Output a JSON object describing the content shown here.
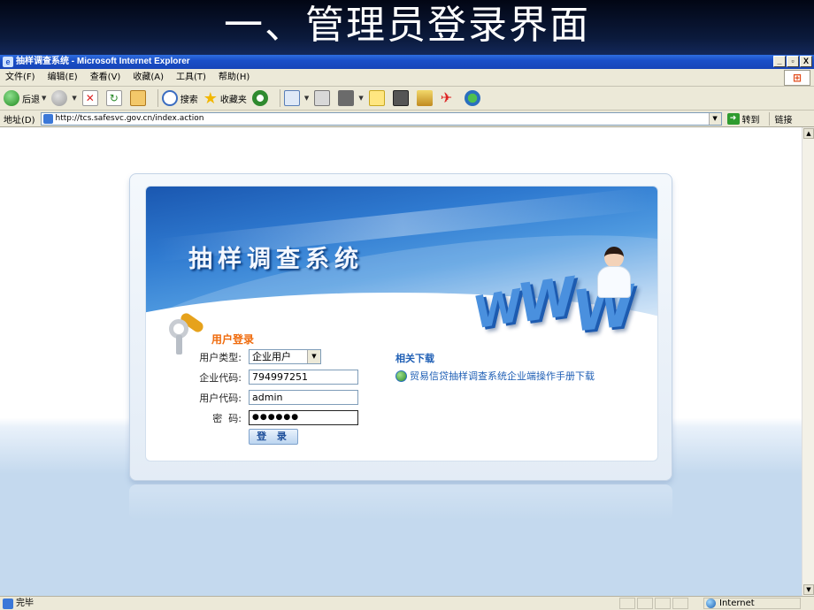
{
  "slide": {
    "title": "一、管理员登录界面"
  },
  "window": {
    "title": "抽样调查系统 - Microsoft Internet Explorer",
    "controls": [
      "_",
      "▫",
      "X"
    ]
  },
  "menu": [
    "文件(F)",
    "编辑(E)",
    "查看(V)",
    "收藏(A)",
    "工具(T)",
    "帮助(H)"
  ],
  "toolbar": {
    "back": "后退",
    "search": "搜索",
    "favorites": "收藏夹"
  },
  "address": {
    "label": "地址(D)",
    "url": "http://tcs.safesvc.gov.cn/index.action",
    "go": "转到",
    "links": "链接"
  },
  "login": {
    "system_title": "抽样调查系统",
    "heading": "用户登录",
    "user_type_label": "用户类型:",
    "user_type_value": "企业用户",
    "company_code_label": "企业代码:",
    "company_code_value": "794997251",
    "user_code_label": "用户代码:",
    "user_code_value": "admin",
    "password_label": "密  码:",
    "password_value": "●●●●●●",
    "submit": "登 录"
  },
  "related": {
    "title": "相关下载",
    "link": "贸易信贷抽样调查系统企业端操作手册下载"
  },
  "status": {
    "text": "完毕",
    "zone": "Internet"
  }
}
